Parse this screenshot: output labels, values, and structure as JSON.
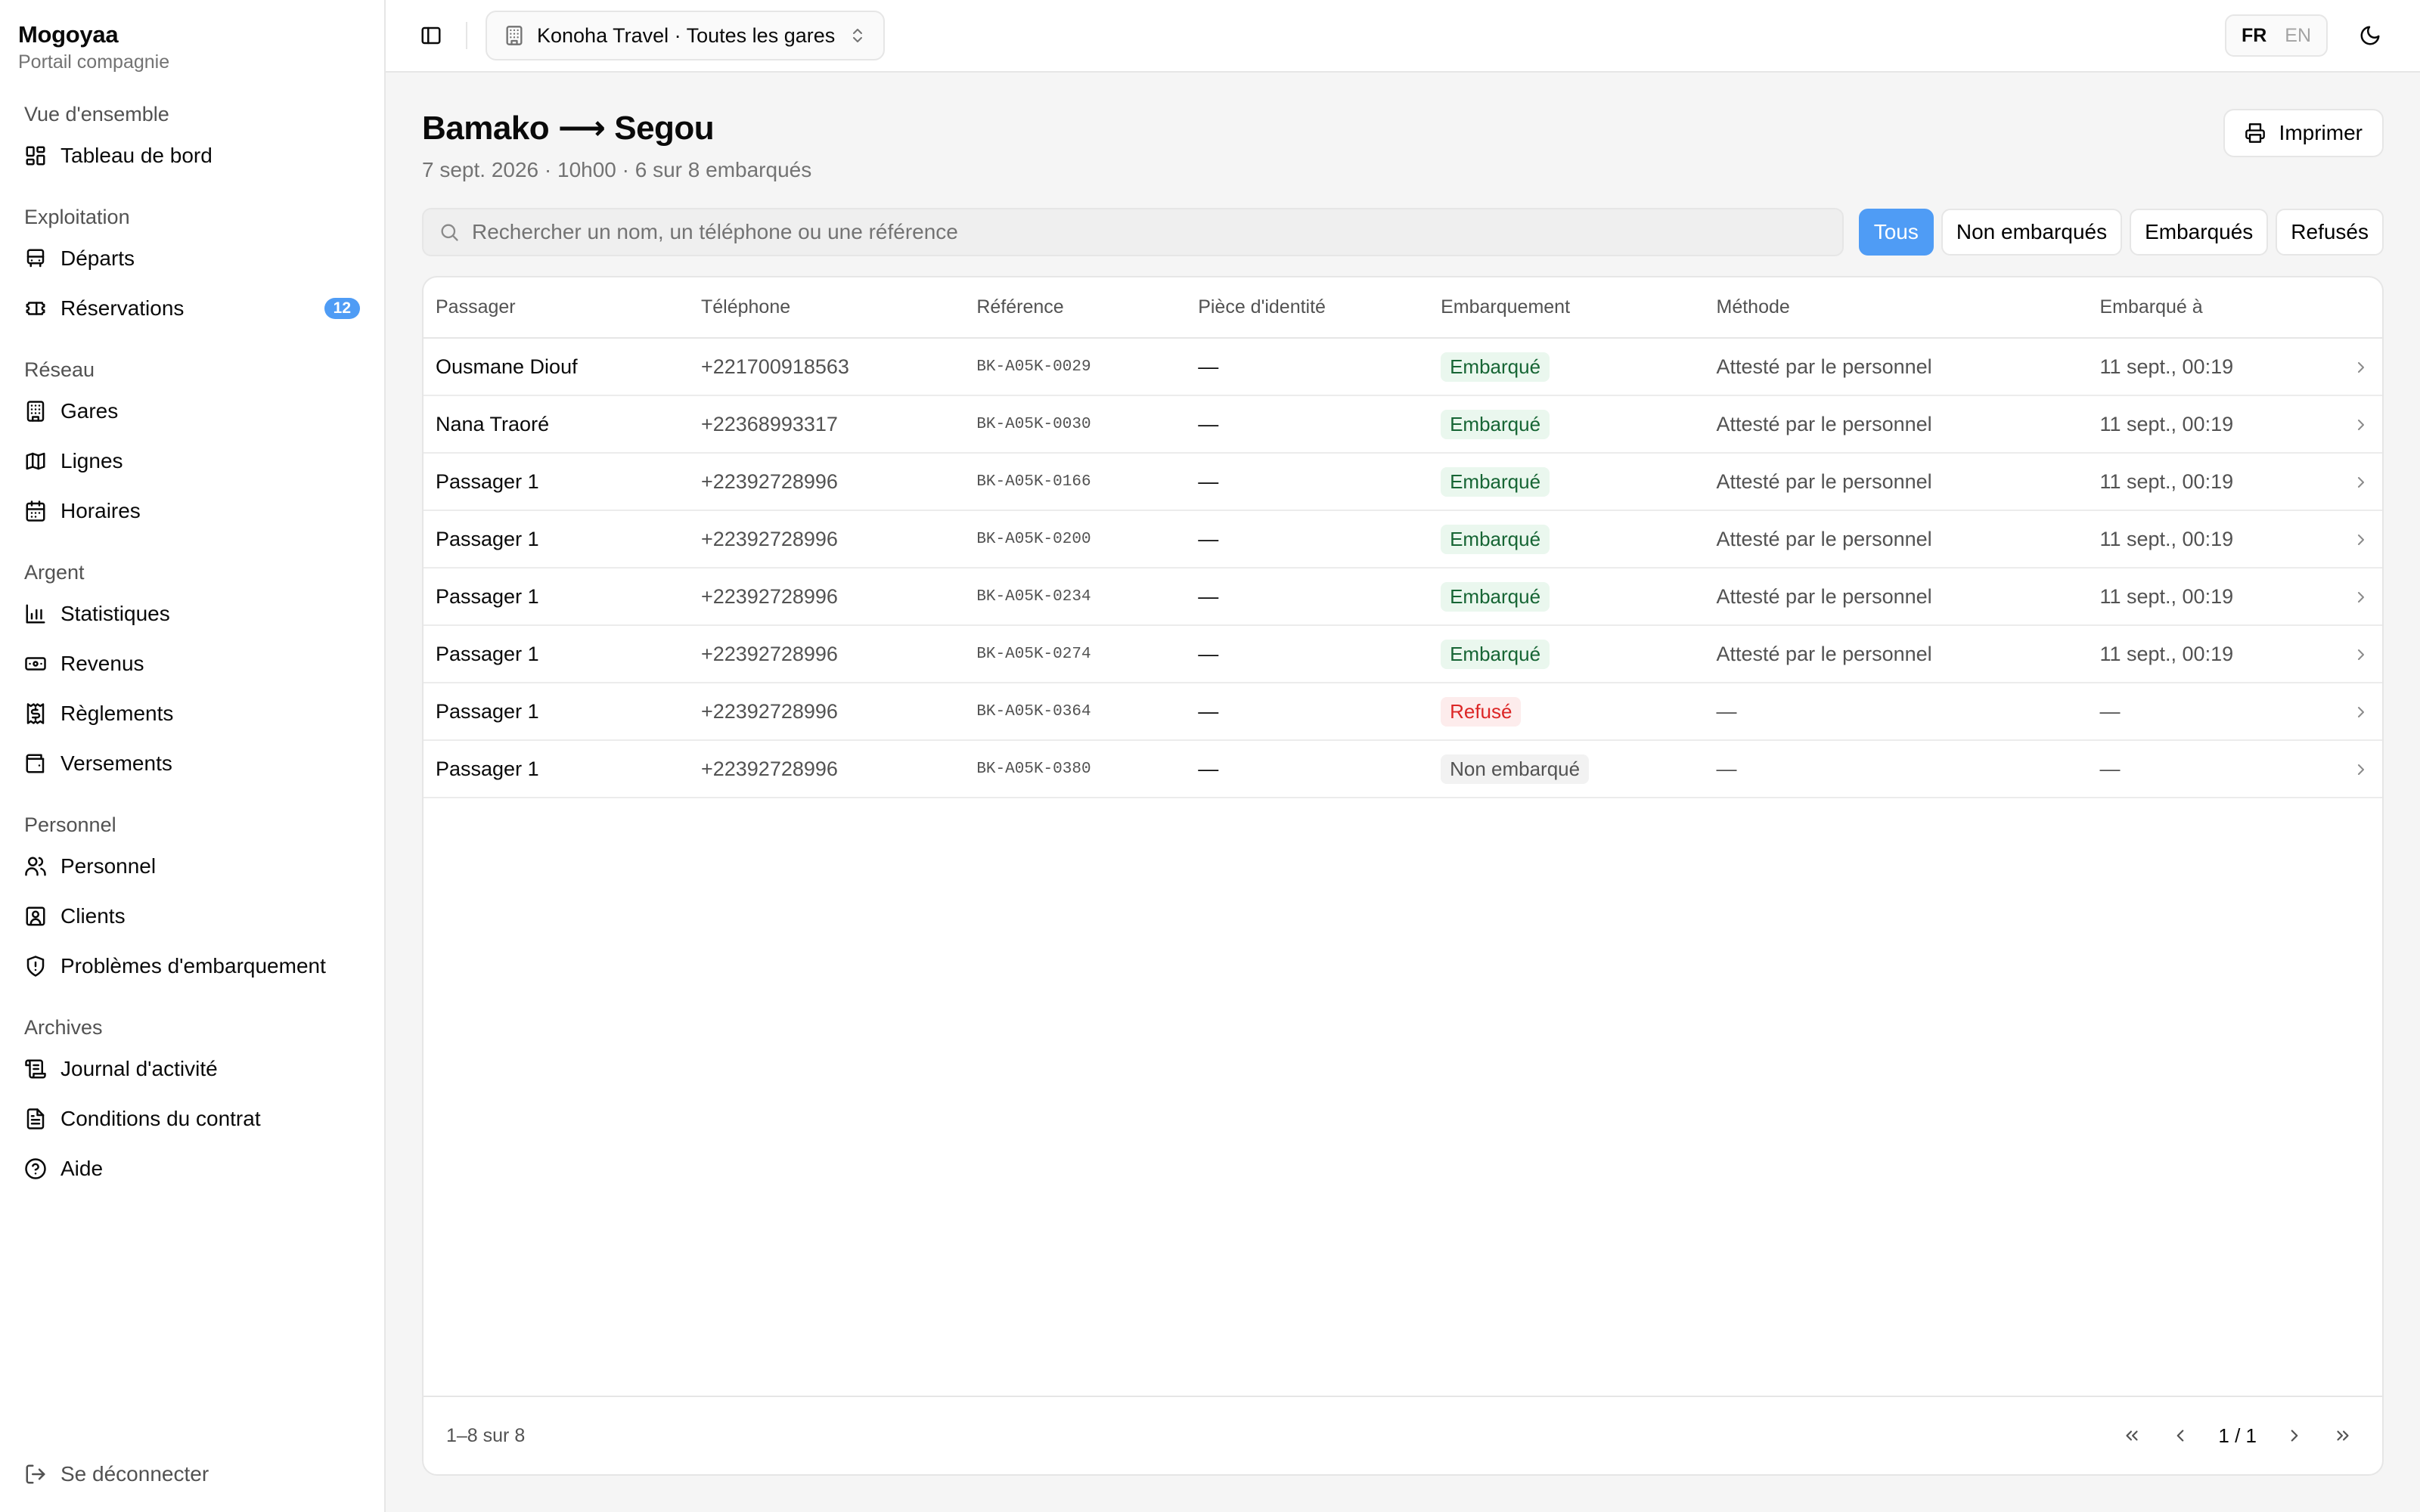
{
  "brand": {
    "name": "Mogoyaa",
    "subtitle": "Portail compagnie"
  },
  "nav": [
    {
      "label": "Vue d'ensemble",
      "items": [
        {
          "label": "Tableau de bord",
          "icon": "dashboard-icon"
        }
      ]
    },
    {
      "label": "Exploitation",
      "items": [
        {
          "label": "Départs",
          "icon": "bus-icon"
        },
        {
          "label": "Réservations",
          "icon": "ticket-icon",
          "badge": "12"
        }
      ]
    },
    {
      "label": "Réseau",
      "items": [
        {
          "label": "Gares",
          "icon": "building-icon"
        },
        {
          "label": "Lignes",
          "icon": "map-icon"
        },
        {
          "label": "Horaires",
          "icon": "calendar-icon"
        }
      ]
    },
    {
      "label": "Argent",
      "items": [
        {
          "label": "Statistiques",
          "icon": "chart-icon"
        },
        {
          "label": "Revenus",
          "icon": "banknote-icon"
        },
        {
          "label": "Règlements",
          "icon": "receipt-icon"
        },
        {
          "label": "Versements",
          "icon": "wallet-icon"
        }
      ]
    },
    {
      "label": "Personnel",
      "items": [
        {
          "label": "Personnel",
          "icon": "users-icon"
        },
        {
          "label": "Clients",
          "icon": "contact-icon"
        },
        {
          "label": "Problèmes d'embarquement",
          "icon": "shield-alert-icon"
        }
      ]
    },
    {
      "label": "Archives",
      "items": [
        {
          "label": "Journal d'activité",
          "icon": "scroll-icon"
        },
        {
          "label": "Conditions du contrat",
          "icon": "document-icon"
        },
        {
          "label": "Aide",
          "icon": "help-icon"
        }
      ]
    }
  ],
  "logout_label": "Se déconnecter",
  "topbar": {
    "company_select": "Konoha Travel · Toutes les gares",
    "lang_fr": "FR",
    "lang_en": "EN"
  },
  "page": {
    "title": "Bamako ⟶ Segou",
    "subtitle": "7 sept. 2026 · 10h00 · 6 sur 8 embarqués",
    "print_label": "Imprimer",
    "search_placeholder": "Rechercher un nom, un téléphone ou une référence",
    "search_value": "",
    "filters": [
      "Tous",
      "Non embarqués",
      "Embarqués",
      "Refusés"
    ],
    "active_filter": "Tous"
  },
  "table": {
    "columns": [
      "Passager",
      "Téléphone",
      "Référence",
      "Pièce d'identité",
      "Embarquement",
      "Méthode",
      "Embarqué à"
    ],
    "rows": [
      {
        "name": "Ousmane Diouf",
        "phone": "+221700918563",
        "ref": "BK-A05K-0029",
        "id_doc": "—",
        "status": "Embarqué",
        "status_kind": "ok",
        "method": "Attesté par le personnel",
        "boarded_at": "11 sept., 00:19"
      },
      {
        "name": "Nana Traoré",
        "phone": "+22368993317",
        "ref": "BK-A05K-0030",
        "id_doc": "—",
        "status": "Embarqué",
        "status_kind": "ok",
        "method": "Attesté par le personnel",
        "boarded_at": "11 sept., 00:19"
      },
      {
        "name": "Passager 1",
        "phone": "+22392728996",
        "ref": "BK-A05K-0166",
        "id_doc": "—",
        "status": "Embarqué",
        "status_kind": "ok",
        "method": "Attesté par le personnel",
        "boarded_at": "11 sept., 00:19"
      },
      {
        "name": "Passager 1",
        "phone": "+22392728996",
        "ref": "BK-A05K-0200",
        "id_doc": "—",
        "status": "Embarqué",
        "status_kind": "ok",
        "method": "Attesté par le personnel",
        "boarded_at": "11 sept., 00:19"
      },
      {
        "name": "Passager 1",
        "phone": "+22392728996",
        "ref": "BK-A05K-0234",
        "id_doc": "—",
        "status": "Embarqué",
        "status_kind": "ok",
        "method": "Attesté par le personnel",
        "boarded_at": "11 sept., 00:19"
      },
      {
        "name": "Passager 1",
        "phone": "+22392728996",
        "ref": "BK-A05K-0274",
        "id_doc": "—",
        "status": "Embarqué",
        "status_kind": "ok",
        "method": "Attesté par le personnel",
        "boarded_at": "11 sept., 00:19"
      },
      {
        "name": "Passager 1",
        "phone": "+22392728996",
        "ref": "BK-A05K-0364",
        "id_doc": "—",
        "status": "Refusé",
        "status_kind": "ko",
        "method": "—",
        "boarded_at": "—"
      },
      {
        "name": "Passager 1",
        "phone": "+22392728996",
        "ref": "BK-A05K-0380",
        "id_doc": "—",
        "status": "Non embarqué",
        "status_kind": "none",
        "method": "—",
        "boarded_at": "—"
      }
    ],
    "footer_count": "1–8 sur 8",
    "page_info": "1 / 1"
  },
  "colors": {
    "accent": "#4f9cf5",
    "ok_text": "#166534",
    "ok_bg": "#eaf7ee",
    "ko_text": "#dc2626",
    "ko_bg": "#fdecec"
  }
}
